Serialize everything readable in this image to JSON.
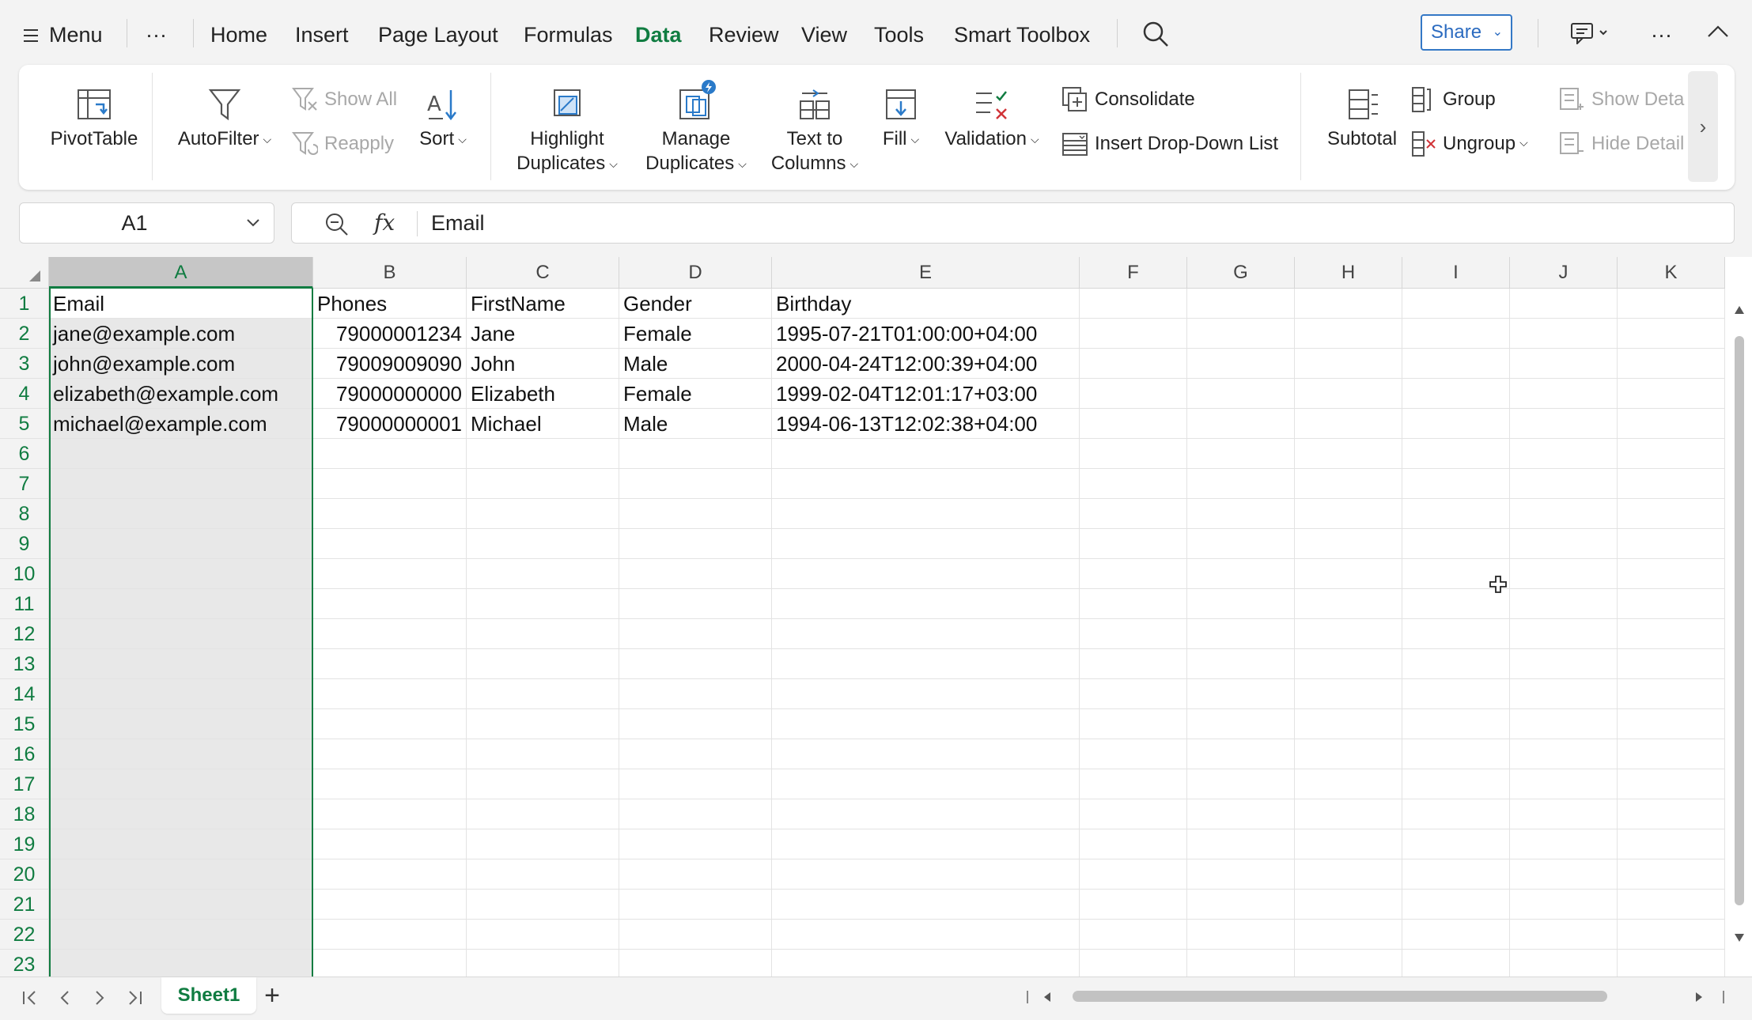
{
  "menubar": {
    "menu_label": "Menu",
    "more_label": "···",
    "tabs": [
      "Home",
      "Insert",
      "Page Layout",
      "Formulas",
      "Data",
      "Review",
      "View",
      "Tools",
      "Smart Toolbox"
    ],
    "active_tab": "Data",
    "share_label": "Share",
    "overflow_label": "···"
  },
  "ribbon": {
    "pivottable": "PivotTable",
    "autofilter": "AutoFilter",
    "show_all": "Show All",
    "reapply": "Reapply",
    "sort": "Sort",
    "highlight_1": "Highlight",
    "highlight_2": "Duplicates",
    "manage_1": "Manage",
    "manage_2": "Duplicates",
    "text_1": "Text to",
    "text_2": "Columns",
    "fill": "Fill",
    "validation": "Validation",
    "consolidate": "Consolidate",
    "insert_dropdown": "Insert Drop-Down List",
    "subtotal": "Subtotal",
    "group": "Group",
    "ungroup": "Ungroup",
    "show_detail": "Show Detai",
    "hide_detail": "Hide Detail"
  },
  "formula": {
    "namebox": "A1",
    "fx": "fx",
    "value": "Email"
  },
  "grid": {
    "columns": [
      "A",
      "B",
      "C",
      "D",
      "E",
      "F",
      "G",
      "H",
      "I",
      "J",
      "K"
    ],
    "selected_column": "A",
    "row_numbers": [
      "1",
      "2",
      "3",
      "4",
      "5",
      "6",
      "7",
      "8",
      "9",
      "10",
      "11",
      "12",
      "13",
      "14",
      "15",
      "16",
      "17",
      "18",
      "19",
      "20",
      "21",
      "22",
      "23"
    ],
    "rows": [
      [
        "Email",
        "Phones",
        "FirstName",
        "Gender",
        "Birthday"
      ],
      [
        "jane@example.com",
        "79000001234",
        "Jane",
        "Female",
        "1995-07-21T01:00:00+04:00"
      ],
      [
        "john@example.com",
        "79009009090",
        "John",
        "Male",
        "2000-04-24T12:00:39+04:00"
      ],
      [
        "elizabeth@example.com",
        "79000000000",
        "Elizabeth",
        "Female",
        "1999-02-04T12:01:17+03:00"
      ],
      [
        "michael@example.com",
        "79000000001",
        "Michael",
        "Male",
        "1994-06-13T12:02:38+04:00"
      ]
    ]
  },
  "sheets": {
    "tabs": [
      "Sheet1"
    ],
    "add_label": "+"
  },
  "colors": {
    "accent": "#107c41",
    "share_blue": "#2b6bc0"
  }
}
